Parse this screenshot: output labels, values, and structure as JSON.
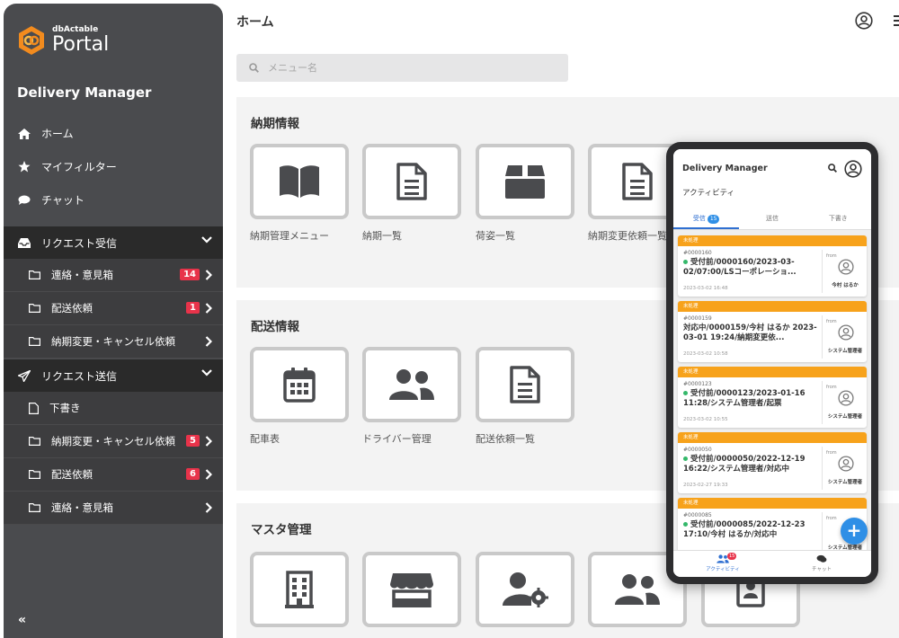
{
  "sidebar": {
    "logo_small": "dbActable",
    "logo_big": "Portal",
    "app_title": "Delivery Manager",
    "nav": [
      {
        "label": "ホーム",
        "icon": "home-icon"
      },
      {
        "label": "マイフィルター",
        "icon": "star-icon"
      },
      {
        "label": "チャット",
        "icon": "chat-icon"
      }
    ],
    "received_group": {
      "label": "リクエスト受信",
      "items": [
        {
          "label": "連絡・意見箱",
          "badge": "14"
        },
        {
          "label": "配送依頼",
          "badge": "1"
        },
        {
          "label": "納期変更・キャンセル依頼",
          "badge": ""
        }
      ]
    },
    "sent_group": {
      "label": "リクエスト送信",
      "items": [
        {
          "label": "下書き",
          "badge": ""
        },
        {
          "label": "納期変更・キャンセル依頼",
          "badge": "5"
        },
        {
          "label": "配送依頼",
          "badge": "6"
        },
        {
          "label": "連絡・意見箱",
          "badge": ""
        }
      ]
    },
    "collapse_label": "«"
  },
  "header": {
    "title": "ホーム"
  },
  "search": {
    "placeholder": "メニュー名"
  },
  "sections": [
    {
      "title": "納期情報",
      "tiles": [
        {
          "label": "納期管理メニュー",
          "icon": "book-icon"
        },
        {
          "label": "納期一覧",
          "icon": "document-icon"
        },
        {
          "label": "荷姿一覧",
          "icon": "box-icon"
        },
        {
          "label": "納期変更依頼一覧",
          "icon": "document-icon"
        }
      ]
    },
    {
      "title": "配送情報",
      "tiles": [
        {
          "label": "配車表",
          "icon": "calendar-icon"
        },
        {
          "label": "ドライバー管理",
          "icon": "users-icon"
        },
        {
          "label": "配送依頼一覧",
          "icon": "document-icon"
        }
      ]
    },
    {
      "title": "マスタ管理",
      "tiles": [
        {
          "label": "",
          "icon": "building-icon"
        },
        {
          "label": "",
          "icon": "store-icon"
        },
        {
          "label": "",
          "icon": "user-gear-icon"
        },
        {
          "label": "",
          "icon": "users-icon"
        },
        {
          "label": "",
          "icon": "contact-book-icon"
        }
      ]
    }
  ],
  "phone": {
    "title": "Delivery Manager",
    "subtitle": "アクティビティ",
    "tabs": [
      {
        "label": "受信",
        "count": "15",
        "active": true
      },
      {
        "label": "送信",
        "count": "",
        "active": false
      },
      {
        "label": "下書き",
        "count": "",
        "active": false
      }
    ],
    "cards": [
      {
        "tag": "未処理",
        "id": "#0000160",
        "title": "受付前/0000160/2023-03-02/07:00/LSコーポレーショ...",
        "date": "2023-03-02 16:48",
        "from_label": "from",
        "from_name": "今村 はるか"
      },
      {
        "tag": "未処理",
        "id": "#0000159",
        "title": "対応中/0000159/今村 はるか 2023-03-01 19:24/納期変更依...",
        "date": "2023-03-02 10:58",
        "from_label": "from",
        "from_name": "システム管理者"
      },
      {
        "tag": "未処理",
        "id": "#0000123",
        "title": "受付前/0000123/2023-01-16 11:28/システム管理者/起票",
        "date": "2023-03-02 10:55",
        "from_label": "from",
        "from_name": "システム管理者"
      },
      {
        "tag": "未処理",
        "id": "#0000050",
        "title": "受付前/0000050/2022-12-19 16:22/システム管理者/対応中",
        "date": "2023-02-27 19:33",
        "from_label": "from",
        "from_name": "システム管理者"
      },
      {
        "tag": "未処理",
        "id": "#0000085",
        "title": "受付前/0000085/2022-12-23 17:10/今村 はるか/対応中",
        "date": "",
        "from_label": "from",
        "from_name": "システム管理者"
      }
    ],
    "fab_label": "+",
    "bottom_nav": [
      {
        "label": "アクティビティ",
        "badge": "15",
        "active": true
      },
      {
        "label": "チャット",
        "badge": "",
        "active": false
      }
    ]
  },
  "colors": {
    "sidebar_bg": "#4a4b4e",
    "group_header_bg": "#2a2a2a",
    "badge_red": "#e8334a",
    "accent_blue": "#2f8fe6",
    "tag_orange": "#f7a21b",
    "logo_orange": "#f28b1e"
  }
}
